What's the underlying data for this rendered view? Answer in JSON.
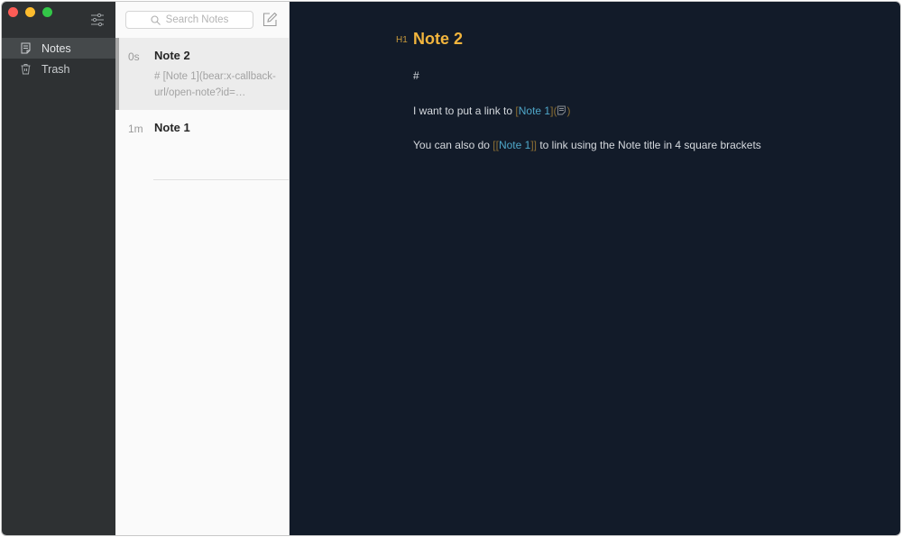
{
  "window": {
    "controls": [
      "close",
      "minimize",
      "maximize"
    ]
  },
  "sidebar": {
    "filter_icon": "sliders-icon",
    "items": [
      {
        "label": "Notes",
        "icon": "notes-icon",
        "active": true
      },
      {
        "label": "Trash",
        "icon": "trash-icon",
        "active": false
      }
    ]
  },
  "note_list": {
    "search_placeholder": "Search Notes",
    "compose_icon": "compose-icon",
    "notes": [
      {
        "time": "0s",
        "title": "Note 2",
        "preview": "# [Note 1](bear:x-callback-url/open-note?id=…",
        "selected": true
      },
      {
        "time": "1m",
        "title": "Note 1",
        "preview": "",
        "selected": false
      }
    ]
  },
  "editor": {
    "heading_marker": "H1",
    "title": "Note 2",
    "line1": "#",
    "line2": {
      "prefix": "I want to put a link to ",
      "open_bracket": "[",
      "link_text": "Note 1",
      "close_open": "](",
      "close_paren": ")"
    },
    "line3": {
      "prefix": "You can also do ",
      "open_brackets": "[[",
      "link_text": "Note 1",
      "close_brackets": "]]",
      "suffix": " to link using the Note title in 4 square brackets"
    }
  },
  "colors": {
    "sidebar_bg": "#2e3133",
    "editor_bg": "#121b29",
    "heading": "#f2b53d",
    "link": "#4fa7c9"
  }
}
